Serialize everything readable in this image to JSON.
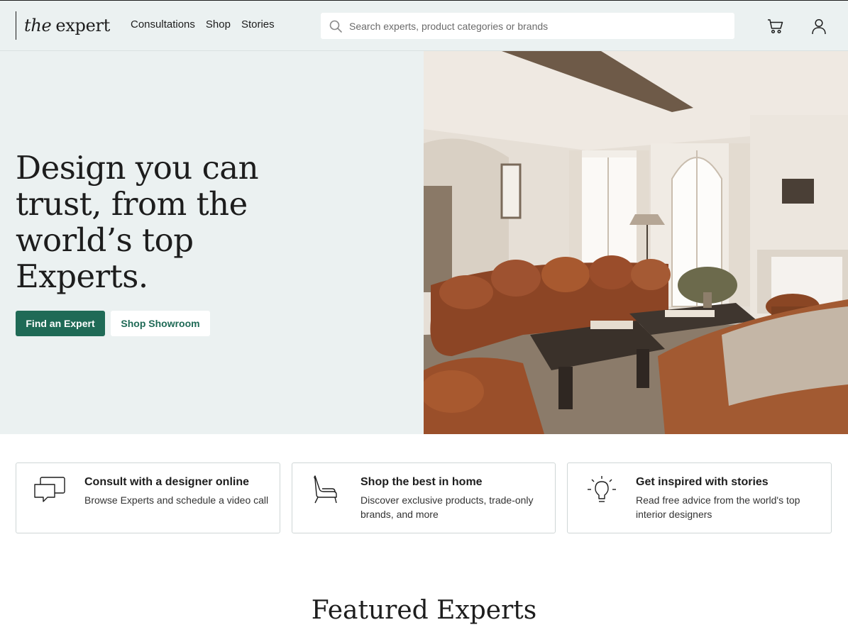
{
  "header": {
    "logo_the": "the",
    "logo_expert": "expert",
    "nav": [
      "Consultations",
      "Shop",
      "Stories"
    ],
    "search_placeholder": "Search experts, product categories or brands"
  },
  "hero": {
    "title": "Design you can trust, from the world’s top Experts.",
    "primary_button": "Find an Expert",
    "secondary_button": "Shop Showroom"
  },
  "features": [
    {
      "icon": "chat-bubbles-icon",
      "title": "Consult with a designer online",
      "description": "Browse Experts and schedule a video call"
    },
    {
      "icon": "lounge-chair-icon",
      "title": "Shop the best in home",
      "description": "Discover exclusive products, trade-only brands, and more"
    },
    {
      "icon": "lightbulb-icon",
      "title": "Get inspired with stories",
      "description": "Read free advice from the world's top interior designers"
    }
  ],
  "featured_heading": "Featured Experts",
  "colors": {
    "brand_green": "#1f6a56",
    "hero_bg": "#ebf1f1"
  }
}
